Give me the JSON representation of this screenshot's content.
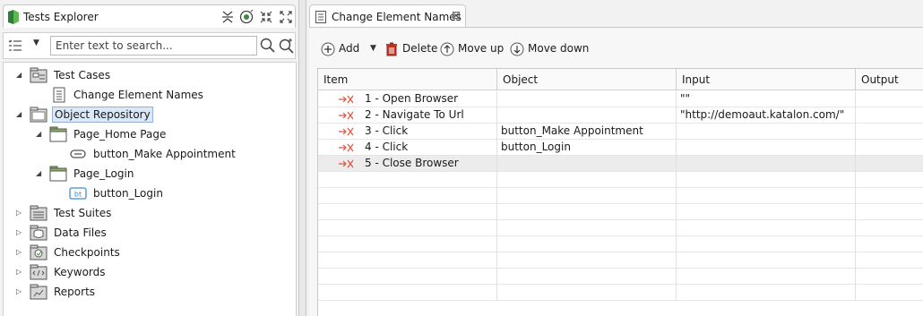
{
  "explorer": {
    "title": "Tests Explorer",
    "search_placeholder": "Enter text to search...",
    "tree": [
      {
        "label": "Test Cases",
        "icon": "test-cases-folder-icon"
      },
      {
        "label": "Change Element Names",
        "icon": "test-case-icon"
      },
      {
        "label": "Object Repository",
        "icon": "object-repository-icon"
      },
      {
        "label": "Page_Home Page",
        "icon": "folder-icon"
      },
      {
        "label": "button_Make Appointment",
        "icon": "test-object-icon"
      },
      {
        "label": "Page_Login",
        "icon": "folder-icon"
      },
      {
        "label": "button_Login",
        "icon": "button-object-icon"
      },
      {
        "label": "Test Suites",
        "icon": "test-suites-icon"
      },
      {
        "label": "Data Files",
        "icon": "data-files-icon"
      },
      {
        "label": "Checkpoints",
        "icon": "checkpoints-icon"
      },
      {
        "label": "Keywords",
        "icon": "keywords-icon"
      },
      {
        "label": "Reports",
        "icon": "reports-icon"
      }
    ],
    "bt_badge": "bt"
  },
  "editor": {
    "tab_title": "Change Element Names",
    "toolbar": {
      "add": "Add",
      "delete": "Delete",
      "move_up": "Move up",
      "move_down": "Move down"
    },
    "columns": [
      "Item",
      "Object",
      "Input",
      "Output"
    ],
    "rows": [
      {
        "item": "1 - Open Browser",
        "object": "",
        "input": "\"\"",
        "output": ""
      },
      {
        "item": "2 - Navigate To Url",
        "object": "",
        "input": "\"http://demoaut.katalon.com/\"",
        "output": ""
      },
      {
        "item": "3 - Click",
        "object": "button_Make Appointment",
        "input": "",
        "output": ""
      },
      {
        "item": "4 - Click",
        "object": "button_Login",
        "input": "",
        "output": ""
      },
      {
        "item": "5 - Close Browser",
        "object": "",
        "input": "",
        "output": ""
      }
    ]
  },
  "colors": {
    "selection": "#dce8f5",
    "step_icon": "#e0533a",
    "folder_green": "#8db35a",
    "delete_red": "#c0392b"
  }
}
